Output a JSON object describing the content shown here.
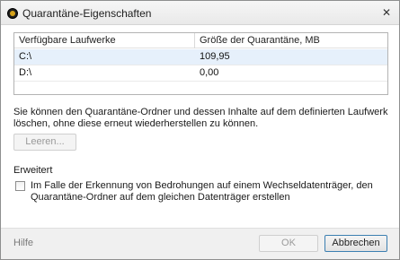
{
  "window": {
    "title": "Quarantäne-Eigenschaften",
    "close_glyph": "✕"
  },
  "table": {
    "headers": [
      "Verfügbare Laufwerke",
      "Größe der Quarantäne, MB"
    ],
    "rows": [
      [
        "C:\\",
        "109,95"
      ],
      [
        "D:\\",
        "0,00"
      ]
    ],
    "selected_row": 0
  },
  "description": "Sie können den Quarantäne-Ordner und dessen Inhalte auf dem definierten Laufwerk löschen, ohne diese erneut wiederherstellen zu können.",
  "clear_button": {
    "label": "Leeren...",
    "enabled": false
  },
  "advanced": {
    "section_label": "Erweitert",
    "checkbox_label": "Im Falle der Erkennung von Bedrohungen auf einem Wechseldatenträger, den Quarantäne-Ordner auf dem gleichen Datenträger erstellen",
    "checked": false
  },
  "footer": {
    "help": "Hilfe",
    "ok": "OK",
    "ok_enabled": false,
    "cancel": "Abbrechen"
  }
}
